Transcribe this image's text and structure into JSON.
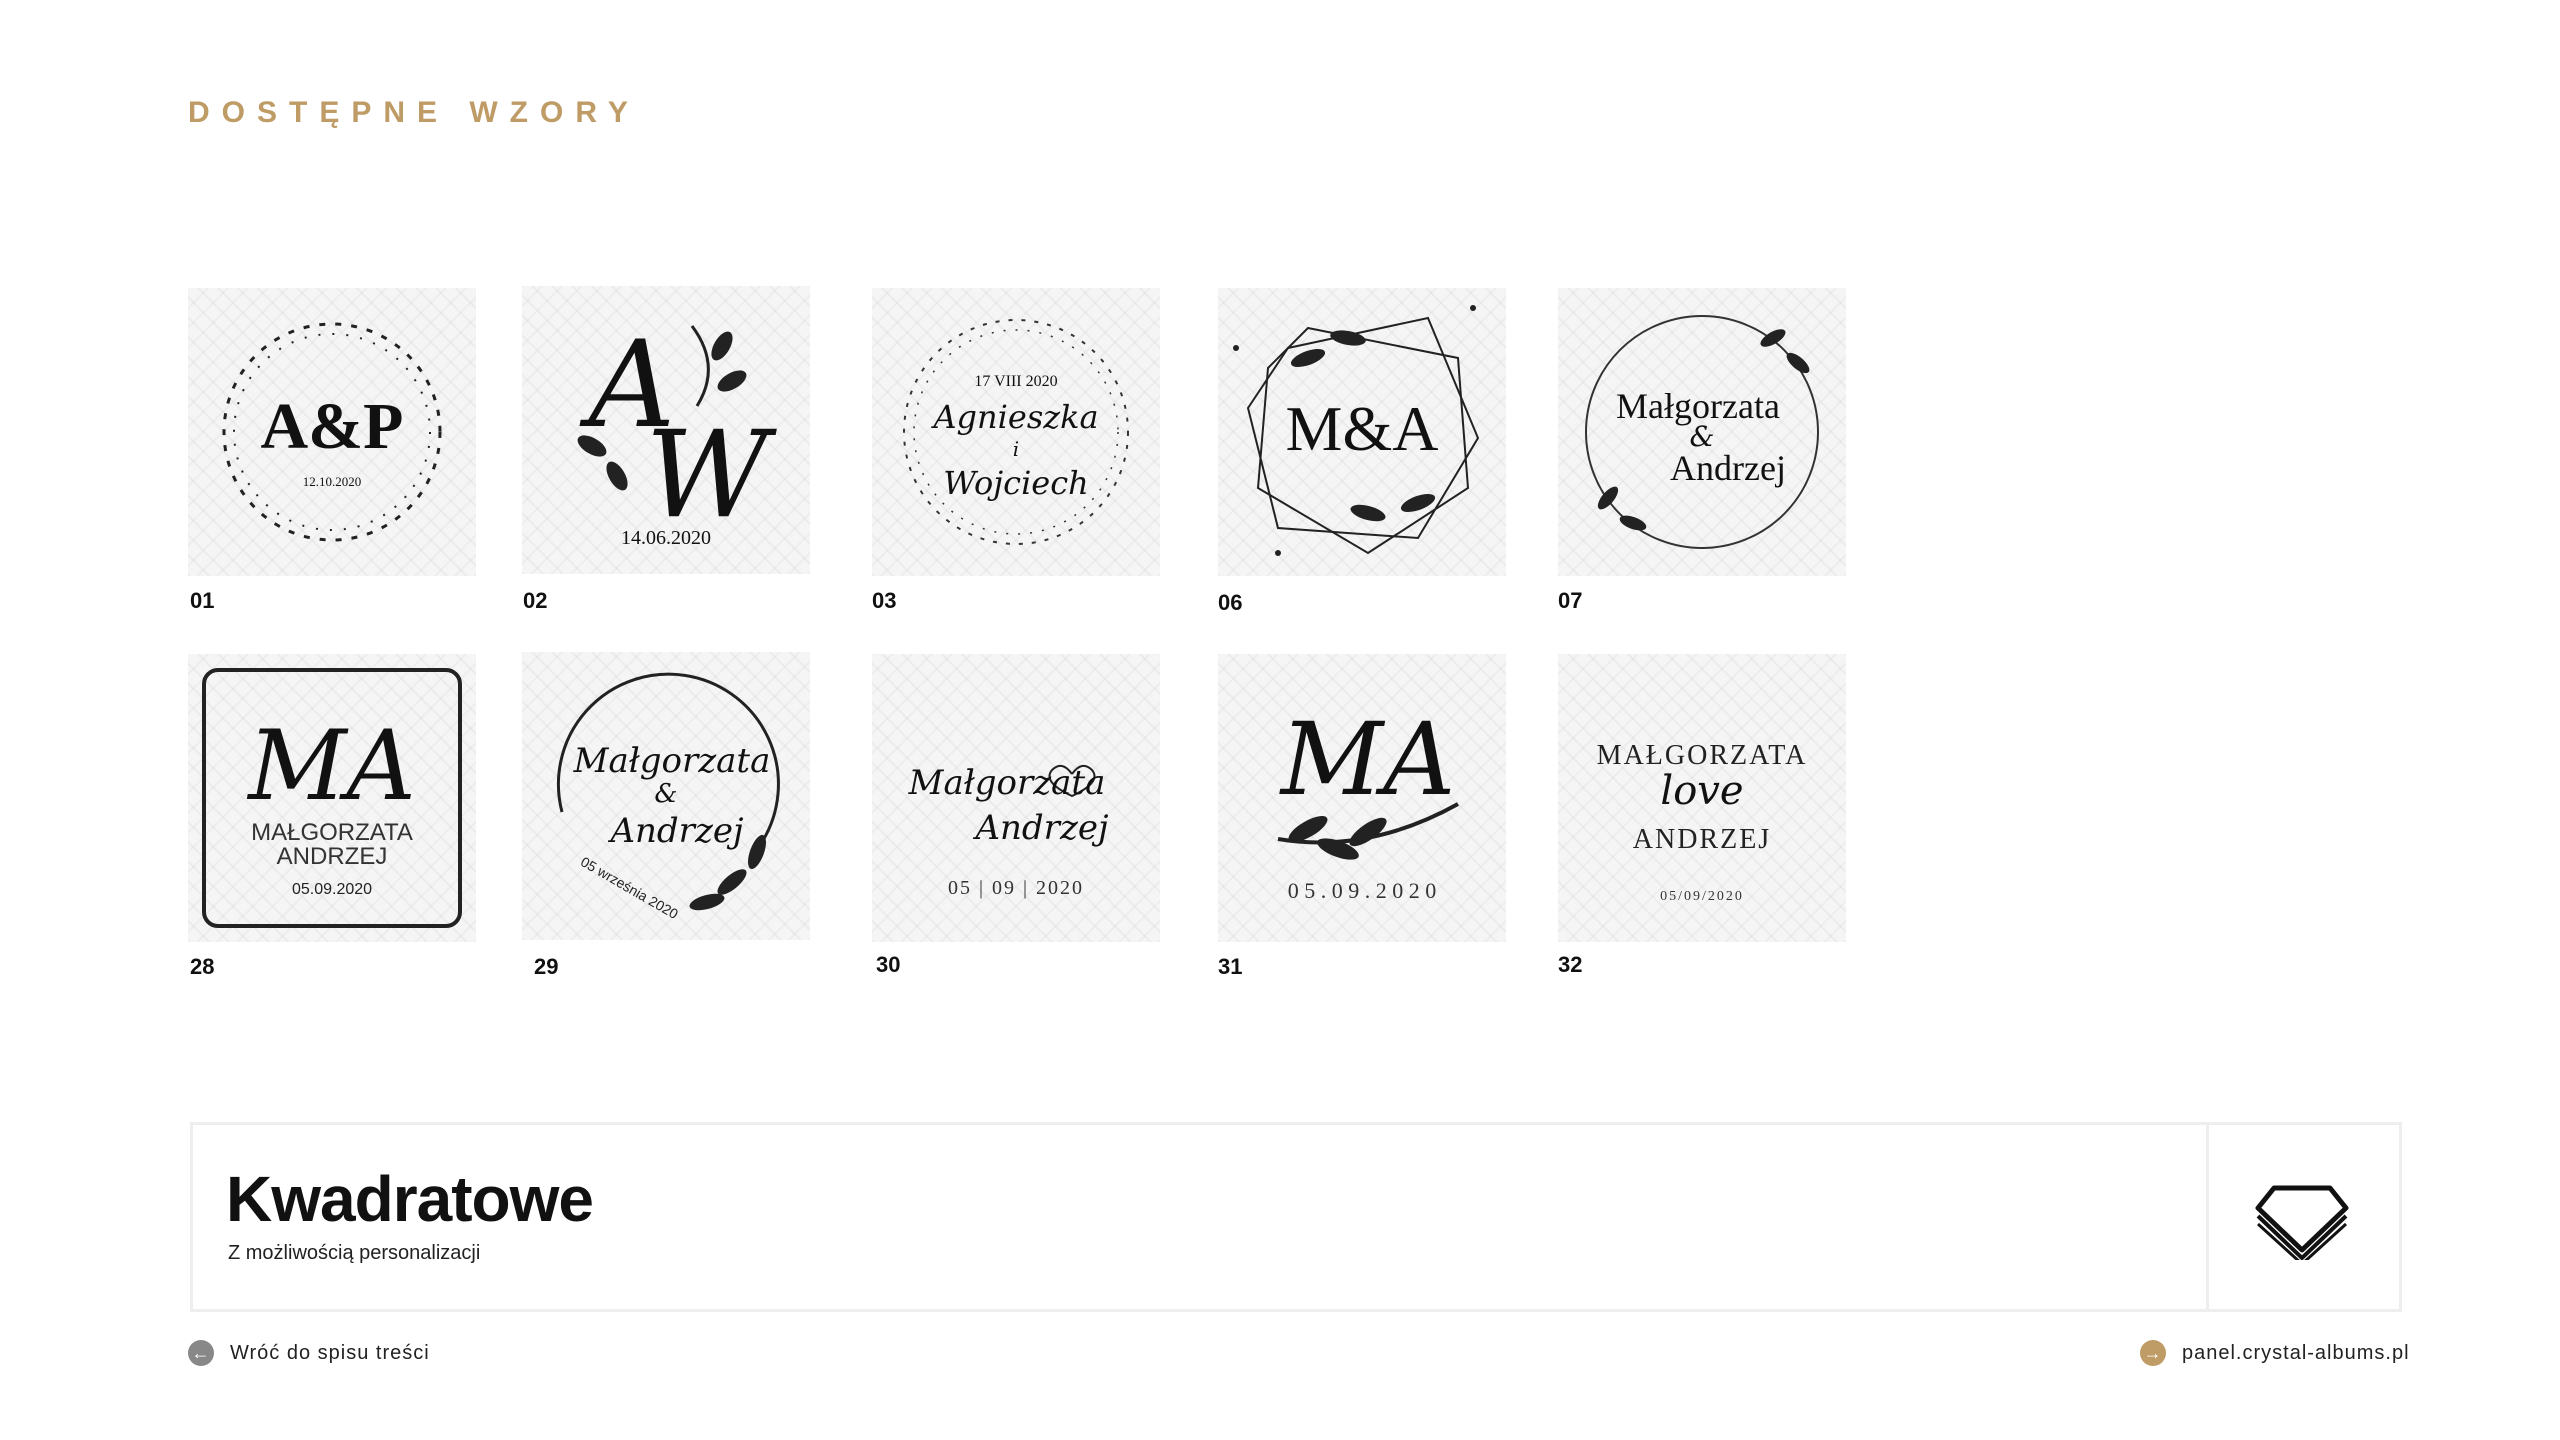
{
  "page_title": "DOSTĘPNE WZORY",
  "designs": [
    {
      "num": "01",
      "initials": "A&P",
      "date": "12.10.2020"
    },
    {
      "num": "02",
      "letter1": "A",
      "letter2": "W",
      "date": "14.06.2020"
    },
    {
      "num": "03",
      "date": "17 VIII 2020",
      "name1": "Agnieszka",
      "conj": "i",
      "name2": "Wojciech"
    },
    {
      "num": "06",
      "initials": "M&A"
    },
    {
      "num": "07",
      "name1": "Małgorzata",
      "amp": "&",
      "name2": "Andrzej"
    },
    {
      "num": "28",
      "mono": "MA",
      "name1": "MAŁGORZATA",
      "name2": "ANDRZEJ",
      "date": "05.09.2020"
    },
    {
      "num": "29",
      "name1": "Małgorzata",
      "amp": "&",
      "name2": "Andrzej",
      "arc": "05 września 2020"
    },
    {
      "num": "30",
      "name1": "Małgorzata",
      "name2": "Andrzej",
      "date": "05 | 09 | 2020"
    },
    {
      "num": "31",
      "mono": "MA",
      "date": "0 5 . 0 9 . 2 0 2 0"
    },
    {
      "num": "32",
      "name1": "MAŁGORZATA",
      "word": "love",
      "name2": "ANDRZEJ",
      "date": "05/09/2020"
    }
  ],
  "banner": {
    "title": "Kwadratowe",
    "subtitle": "Z możliwością personalizacji",
    "icon": "diamond-icon"
  },
  "footer": {
    "back_label": "Wróć do spisu treści",
    "back_icon": "arrow-left-icon",
    "link_label": "panel.crystal-albums.pl",
    "link_icon": "arrow-right-icon"
  },
  "colors": {
    "accent": "#bf9b66",
    "back_circle": "#888888"
  }
}
